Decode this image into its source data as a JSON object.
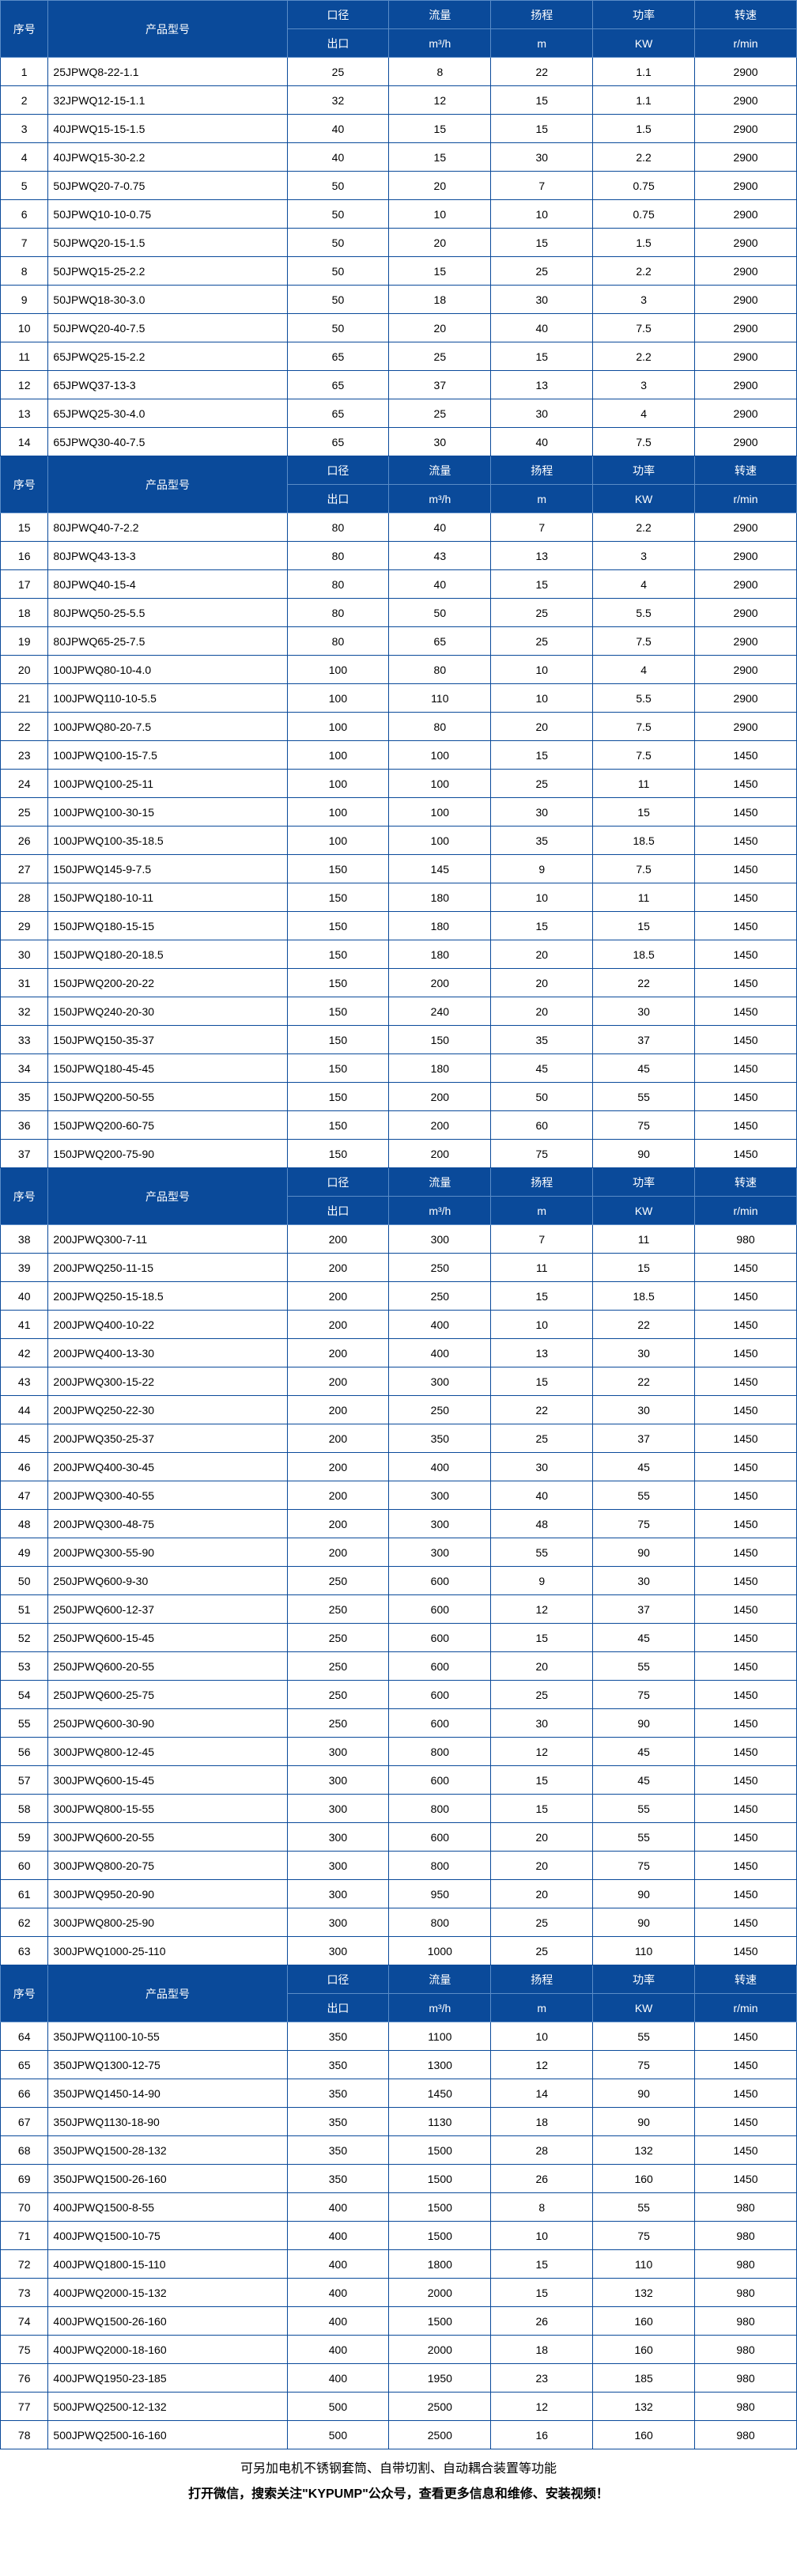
{
  "headers": {
    "no": "序号",
    "model": "产品型号",
    "dia_top": "口径",
    "dia_bot": "出口",
    "flow_top": "流量",
    "flow_bot": "m³/h",
    "head_top": "扬程",
    "head_bot": "m",
    "power_top": "功率",
    "power_bot": "KW",
    "speed_top": "转速",
    "speed_bot": "r/min"
  },
  "sections": [
    {
      "rows": [
        {
          "no": 1,
          "model": "25JPWQ8-22-1.1",
          "dia": 25,
          "flow": 8,
          "head": 22,
          "power": "1.1",
          "speed": 2900
        },
        {
          "no": 2,
          "model": "32JPWQ12-15-1.1",
          "dia": 32,
          "flow": 12,
          "head": 15,
          "power": "1.1",
          "speed": 2900
        },
        {
          "no": 3,
          "model": "40JPWQ15-15-1.5",
          "dia": 40,
          "flow": 15,
          "head": 15,
          "power": "1.5",
          "speed": 2900
        },
        {
          "no": 4,
          "model": "40JPWQ15-30-2.2",
          "dia": 40,
          "flow": 15,
          "head": 30,
          "power": "2.2",
          "speed": 2900
        },
        {
          "no": 5,
          "model": "50JPWQ20-7-0.75",
          "dia": 50,
          "flow": 20,
          "head": 7,
          "power": "0.75",
          "speed": 2900
        },
        {
          "no": 6,
          "model": "50JPWQ10-10-0.75",
          "dia": 50,
          "flow": 10,
          "head": 10,
          "power": "0.75",
          "speed": 2900
        },
        {
          "no": 7,
          "model": "50JPWQ20-15-1.5",
          "dia": 50,
          "flow": 20,
          "head": 15,
          "power": "1.5",
          "speed": 2900
        },
        {
          "no": 8,
          "model": "50JPWQ15-25-2.2",
          "dia": 50,
          "flow": 15,
          "head": 25,
          "power": "2.2",
          "speed": 2900
        },
        {
          "no": 9,
          "model": "50JPWQ18-30-3.0",
          "dia": 50,
          "flow": 18,
          "head": 30,
          "power": "3",
          "speed": 2900
        },
        {
          "no": 10,
          "model": "50JPWQ20-40-7.5",
          "dia": 50,
          "flow": 20,
          "head": 40,
          "power": "7.5",
          "speed": 2900
        },
        {
          "no": 11,
          "model": "65JPWQ25-15-2.2",
          "dia": 65,
          "flow": 25,
          "head": 15,
          "power": "2.2",
          "speed": 2900
        },
        {
          "no": 12,
          "model": "65JPWQ37-13-3",
          "dia": 65,
          "flow": 37,
          "head": 13,
          "power": "3",
          "speed": 2900
        },
        {
          "no": 13,
          "model": "65JPWQ25-30-4.0",
          "dia": 65,
          "flow": 25,
          "head": 30,
          "power": "4",
          "speed": 2900
        },
        {
          "no": 14,
          "model": "65JPWQ30-40-7.5",
          "dia": 65,
          "flow": 30,
          "head": 40,
          "power": "7.5",
          "speed": 2900
        }
      ]
    },
    {
      "rows": [
        {
          "no": 15,
          "model": "80JPWQ40-7-2.2",
          "dia": 80,
          "flow": 40,
          "head": 7,
          "power": "2.2",
          "speed": 2900
        },
        {
          "no": 16,
          "model": "80JPWQ43-13-3",
          "dia": 80,
          "flow": 43,
          "head": 13,
          "power": "3",
          "speed": 2900
        },
        {
          "no": 17,
          "model": "80JPWQ40-15-4",
          "dia": 80,
          "flow": 40,
          "head": 15,
          "power": "4",
          "speed": 2900
        },
        {
          "no": 18,
          "model": "80JPWQ50-25-5.5",
          "dia": 80,
          "flow": 50,
          "head": 25,
          "power": "5.5",
          "speed": 2900
        },
        {
          "no": 19,
          "model": "80JPWQ65-25-7.5",
          "dia": 80,
          "flow": 65,
          "head": 25,
          "power": "7.5",
          "speed": 2900
        },
        {
          "no": 20,
          "model": "100JPWQ80-10-4.0",
          "dia": 100,
          "flow": 80,
          "head": 10,
          "power": "4",
          "speed": 2900
        },
        {
          "no": 21,
          "model": "100JPWQ110-10-5.5",
          "dia": 100,
          "flow": 110,
          "head": 10,
          "power": "5.5",
          "speed": 2900
        },
        {
          "no": 22,
          "model": "100JPWQ80-20-7.5",
          "dia": 100,
          "flow": 80,
          "head": 20,
          "power": "7.5",
          "speed": 2900
        },
        {
          "no": 23,
          "model": "100JPWQ100-15-7.5",
          "dia": 100,
          "flow": 100,
          "head": 15,
          "power": "7.5",
          "speed": 1450
        },
        {
          "no": 24,
          "model": "100JPWQ100-25-11",
          "dia": 100,
          "flow": 100,
          "head": 25,
          "power": "11",
          "speed": 1450
        },
        {
          "no": 25,
          "model": "100JPWQ100-30-15",
          "dia": 100,
          "flow": 100,
          "head": 30,
          "power": "15",
          "speed": 1450
        },
        {
          "no": 26,
          "model": "100JPWQ100-35-18.5",
          "dia": 100,
          "flow": 100,
          "head": 35,
          "power": "18.5",
          "speed": 1450
        },
        {
          "no": 27,
          "model": "150JPWQ145-9-7.5",
          "dia": 150,
          "flow": 145,
          "head": 9,
          "power": "7.5",
          "speed": 1450
        },
        {
          "no": 28,
          "model": "150JPWQ180-10-11",
          "dia": 150,
          "flow": 180,
          "head": 10,
          "power": "11",
          "speed": 1450
        },
        {
          "no": 29,
          "model": "150JPWQ180-15-15",
          "dia": 150,
          "flow": 180,
          "head": 15,
          "power": "15",
          "speed": 1450
        },
        {
          "no": 30,
          "model": "150JPWQ180-20-18.5",
          "dia": 150,
          "flow": 180,
          "head": 20,
          "power": "18.5",
          "speed": 1450
        },
        {
          "no": 31,
          "model": "150JPWQ200-20-22",
          "dia": 150,
          "flow": 200,
          "head": 20,
          "power": "22",
          "speed": 1450
        },
        {
          "no": 32,
          "model": "150JPWQ240-20-30",
          "dia": 150,
          "flow": 240,
          "head": 20,
          "power": "30",
          "speed": 1450
        },
        {
          "no": 33,
          "model": "150JPWQ150-35-37",
          "dia": 150,
          "flow": 150,
          "head": 35,
          "power": "37",
          "speed": 1450
        },
        {
          "no": 34,
          "model": "150JPWQ180-45-45",
          "dia": 150,
          "flow": 180,
          "head": 45,
          "power": "45",
          "speed": 1450
        },
        {
          "no": 35,
          "model": "150JPWQ200-50-55",
          "dia": 150,
          "flow": 200,
          "head": 50,
          "power": "55",
          "speed": 1450
        },
        {
          "no": 36,
          "model": "150JPWQ200-60-75",
          "dia": 150,
          "flow": 200,
          "head": 60,
          "power": "75",
          "speed": 1450
        },
        {
          "no": 37,
          "model": "150JPWQ200-75-90",
          "dia": 150,
          "flow": 200,
          "head": 75,
          "power": "90",
          "speed": 1450
        }
      ]
    },
    {
      "rows": [
        {
          "no": 38,
          "model": "200JPWQ300-7-11",
          "dia": 200,
          "flow": 300,
          "head": 7,
          "power": "11",
          "speed": 980
        },
        {
          "no": 39,
          "model": "200JPWQ250-11-15",
          "dia": 200,
          "flow": 250,
          "head": 11,
          "power": "15",
          "speed": 1450
        },
        {
          "no": 40,
          "model": "200JPWQ250-15-18.5",
          "dia": 200,
          "flow": 250,
          "head": 15,
          "power": "18.5",
          "speed": 1450
        },
        {
          "no": 41,
          "model": "200JPWQ400-10-22",
          "dia": 200,
          "flow": 400,
          "head": 10,
          "power": "22",
          "speed": 1450
        },
        {
          "no": 42,
          "model": "200JPWQ400-13-30",
          "dia": 200,
          "flow": 400,
          "head": 13,
          "power": "30",
          "speed": 1450
        },
        {
          "no": 43,
          "model": "200JPWQ300-15-22",
          "dia": 200,
          "flow": 300,
          "head": 15,
          "power": "22",
          "speed": 1450
        },
        {
          "no": 44,
          "model": "200JPWQ250-22-30",
          "dia": 200,
          "flow": 250,
          "head": 22,
          "power": "30",
          "speed": 1450
        },
        {
          "no": 45,
          "model": "200JPWQ350-25-37",
          "dia": 200,
          "flow": 350,
          "head": 25,
          "power": "37",
          "speed": 1450
        },
        {
          "no": 46,
          "model": "200JPWQ400-30-45",
          "dia": 200,
          "flow": 400,
          "head": 30,
          "power": "45",
          "speed": 1450
        },
        {
          "no": 47,
          "model": "200JPWQ300-40-55",
          "dia": 200,
          "flow": 300,
          "head": 40,
          "power": "55",
          "speed": 1450
        },
        {
          "no": 48,
          "model": "200JPWQ300-48-75",
          "dia": 200,
          "flow": 300,
          "head": 48,
          "power": "75",
          "speed": 1450
        },
        {
          "no": 49,
          "model": "200JPWQ300-55-90",
          "dia": 200,
          "flow": 300,
          "head": 55,
          "power": "90",
          "speed": 1450
        },
        {
          "no": 50,
          "model": "250JPWQ600-9-30",
          "dia": 250,
          "flow": 600,
          "head": 9,
          "power": "30",
          "speed": 1450
        },
        {
          "no": 51,
          "model": "250JPWQ600-12-37",
          "dia": 250,
          "flow": 600,
          "head": 12,
          "power": "37",
          "speed": 1450
        },
        {
          "no": 52,
          "model": "250JPWQ600-15-45",
          "dia": 250,
          "flow": 600,
          "head": 15,
          "power": "45",
          "speed": 1450
        },
        {
          "no": 53,
          "model": "250JPWQ600-20-55",
          "dia": 250,
          "flow": 600,
          "head": 20,
          "power": "55",
          "speed": 1450
        },
        {
          "no": 54,
          "model": "250JPWQ600-25-75",
          "dia": 250,
          "flow": 600,
          "head": 25,
          "power": "75",
          "speed": 1450
        },
        {
          "no": 55,
          "model": "250JPWQ600-30-90",
          "dia": 250,
          "flow": 600,
          "head": 30,
          "power": "90",
          "speed": 1450
        },
        {
          "no": 56,
          "model": "300JPWQ800-12-45",
          "dia": 300,
          "flow": 800,
          "head": 12,
          "power": "45",
          "speed": 1450
        },
        {
          "no": 57,
          "model": "300JPWQ600-15-45",
          "dia": 300,
          "flow": 600,
          "head": 15,
          "power": "45",
          "speed": 1450
        },
        {
          "no": 58,
          "model": "300JPWQ800-15-55",
          "dia": 300,
          "flow": 800,
          "head": 15,
          "power": "55",
          "speed": 1450
        },
        {
          "no": 59,
          "model": "300JPWQ600-20-55",
          "dia": 300,
          "flow": 600,
          "head": 20,
          "power": "55",
          "speed": 1450
        },
        {
          "no": 60,
          "model": "300JPWQ800-20-75",
          "dia": 300,
          "flow": 800,
          "head": 20,
          "power": "75",
          "speed": 1450
        },
        {
          "no": 61,
          "model": "300JPWQ950-20-90",
          "dia": 300,
          "flow": 950,
          "head": 20,
          "power": "90",
          "speed": 1450
        },
        {
          "no": 62,
          "model": "300JPWQ800-25-90",
          "dia": 300,
          "flow": 800,
          "head": 25,
          "power": "90",
          "speed": 1450
        },
        {
          "no": 63,
          "model": "300JPWQ1000-25-110",
          "dia": 300,
          "flow": 1000,
          "head": 25,
          "power": "110",
          "speed": 1450
        }
      ]
    },
    {
      "rows": [
        {
          "no": 64,
          "model": "350JPWQ1100-10-55",
          "dia": 350,
          "flow": 1100,
          "head": 10,
          "power": "55",
          "speed": 1450
        },
        {
          "no": 65,
          "model": "350JPWQ1300-12-75",
          "dia": 350,
          "flow": 1300,
          "head": 12,
          "power": "75",
          "speed": 1450
        },
        {
          "no": 66,
          "model": "350JPWQ1450-14-90",
          "dia": 350,
          "flow": 1450,
          "head": 14,
          "power": "90",
          "speed": 1450
        },
        {
          "no": 67,
          "model": "350JPWQ1130-18-90",
          "dia": 350,
          "flow": 1130,
          "head": 18,
          "power": "90",
          "speed": 1450
        },
        {
          "no": 68,
          "model": "350JPWQ1500-28-132",
          "dia": 350,
          "flow": 1500,
          "head": 28,
          "power": "132",
          "speed": 1450
        },
        {
          "no": 69,
          "model": "350JPWQ1500-26-160",
          "dia": 350,
          "flow": 1500,
          "head": 26,
          "power": "160",
          "speed": 1450
        },
        {
          "no": 70,
          "model": "400JPWQ1500-8-55",
          "dia": 400,
          "flow": 1500,
          "head": 8,
          "power": "55",
          "speed": 980
        },
        {
          "no": 71,
          "model": "400JPWQ1500-10-75",
          "dia": 400,
          "flow": 1500,
          "head": 10,
          "power": "75",
          "speed": 980
        },
        {
          "no": 72,
          "model": "400JPWQ1800-15-110",
          "dia": 400,
          "flow": 1800,
          "head": 15,
          "power": "110",
          "speed": 980
        },
        {
          "no": 73,
          "model": "400JPWQ2000-15-132",
          "dia": 400,
          "flow": 2000,
          "head": 15,
          "power": "132",
          "speed": 980
        },
        {
          "no": 74,
          "model": "400JPWQ1500-26-160",
          "dia": 400,
          "flow": 1500,
          "head": 26,
          "power": "160",
          "speed": 980
        },
        {
          "no": 75,
          "model": "400JPWQ2000-18-160",
          "dia": 400,
          "flow": 2000,
          "head": 18,
          "power": "160",
          "speed": 980
        },
        {
          "no": 76,
          "model": "400JPWQ1950-23-185",
          "dia": 400,
          "flow": 1950,
          "head": 23,
          "power": "185",
          "speed": 980
        },
        {
          "no": 77,
          "model": "500JPWQ2500-12-132",
          "dia": 500,
          "flow": 2500,
          "head": 12,
          "power": "132",
          "speed": 980
        },
        {
          "no": 78,
          "model": "500JPWQ2500-16-160",
          "dia": 500,
          "flow": 2500,
          "head": 16,
          "power": "160",
          "speed": 980
        }
      ]
    }
  ],
  "footer": {
    "note": "可另加电机不锈钢套筒、自带切割、自动耦合装置等功能",
    "cta": "打开微信，搜索关注\"KYPUMP\"公众号，查看更多信息和维修、安装视频！"
  }
}
